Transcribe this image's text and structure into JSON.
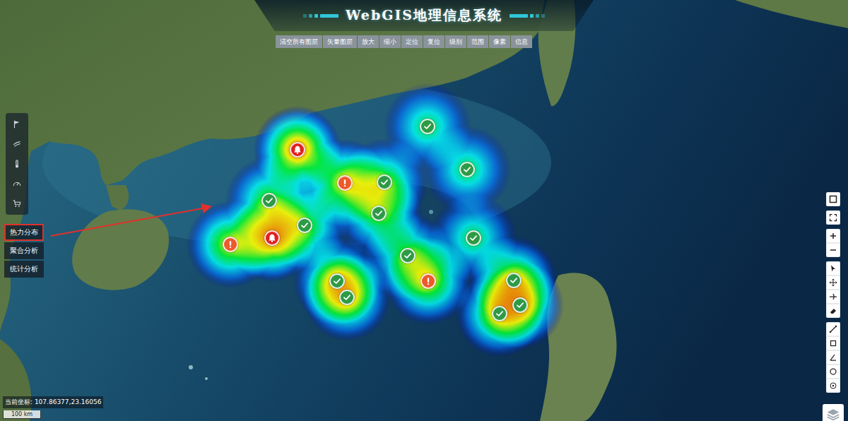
{
  "header": {
    "title": "WebGIS地理信息系统"
  },
  "toolbar": [
    "清空所有图层",
    "矢量图层",
    "放大",
    "缩小",
    "定位",
    "复位",
    "级别",
    "范围",
    "像素",
    "信息"
  ],
  "side_menu": [
    {
      "label": "热力分布",
      "selected": true
    },
    {
      "label": "聚合分析",
      "selected": false
    },
    {
      "label": "统计分析",
      "selected": false
    }
  ],
  "heatmap": {
    "points": [
      {
        "kind": "ok",
        "color": "#2e9a46",
        "level": 0.5
      },
      {
        "kind": "alarm",
        "color": "#e3201f",
        "level": 0.9
      },
      {
        "kind": "ok",
        "color": "#2e9a46",
        "level": 0.5
      },
      {
        "kind": "warn",
        "color": "#ee5a2a",
        "level": 0.75
      },
      {
        "kind": "ok",
        "color": "#2e9a46",
        "level": 0.6
      },
      {
        "kind": "ok",
        "color": "#2e9a46",
        "level": 0.6
      },
      {
        "kind": "ok",
        "color": "#2e9a46",
        "level": 0.6
      },
      {
        "kind": "ok",
        "color": "#2e9a46",
        "level": 0.6
      },
      {
        "kind": "alarm",
        "color": "#e3201f",
        "level": 0.9
      },
      {
        "kind": "warn",
        "color": "#ee5a2a",
        "level": 0.7
      },
      {
        "kind": "ok",
        "color": "#2e9a46",
        "level": 0.5
      },
      {
        "kind": "ok",
        "color": "#2e9a46",
        "level": 0.6
      },
      {
        "kind": "ok",
        "color": "#2e9a46",
        "level": 0.7
      },
      {
        "kind": "ok",
        "color": "#2e9a46",
        "level": 0.7
      },
      {
        "kind": "warn",
        "color": "#ee5a2a",
        "level": 0.7
      },
      {
        "kind": "ok",
        "color": "#2e9a46",
        "level": 0.7
      },
      {
        "kind": "ok",
        "color": "#2e9a46",
        "level": 0.7
      },
      {
        "kind": "ok",
        "color": "#2e9a46",
        "level": 0.7
      }
    ]
  },
  "status": {
    "coordinate": "当前坐标: 107.86377,23.16056",
    "scale": "100 km"
  }
}
